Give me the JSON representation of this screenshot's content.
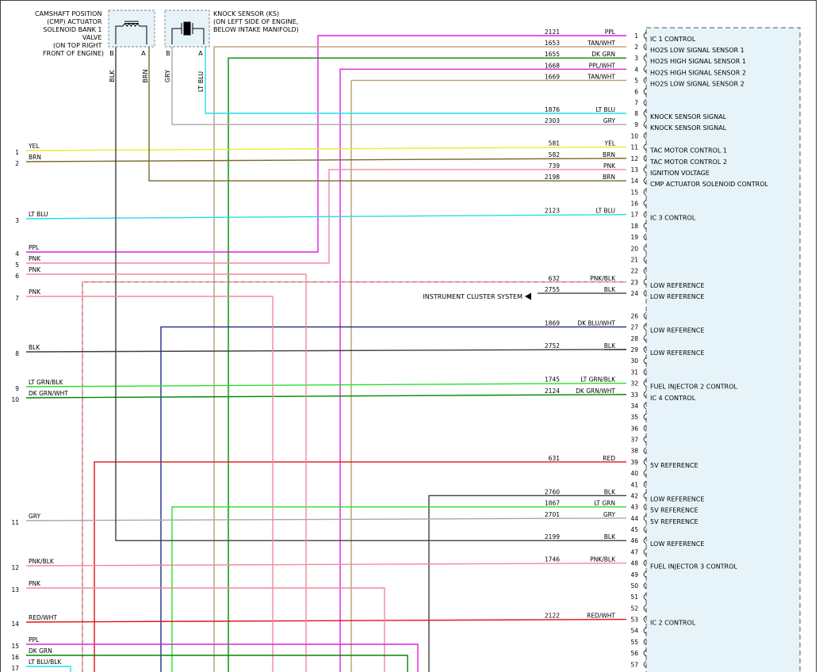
{
  "components": {
    "cmp": {
      "label": [
        "CAMSHAFT POSITION",
        "(CMP) ACTUATOR",
        "SOLENOID BANK 1",
        "VALVE",
        "(ON TOP RIGHT",
        "FRONT OF ENGINE)"
      ],
      "pins": [
        "B",
        "A"
      ],
      "wires": [
        "BLK",
        "BRN"
      ]
    },
    "ks": {
      "label": [
        "KNOCK SENSOR (KS)",
        "(ON LEFT SIDE OF ENGINE,",
        "BELOW INTAKE MANIFOLD)"
      ],
      "pins": [
        "B",
        "A"
      ],
      "wires": [
        "GRY",
        "LT BLU"
      ]
    }
  },
  "reference": {
    "label": "INSTRUMENT CLUSTER SYSTEM",
    "arrow": "arrow-left-icon"
  },
  "module_pins": [
    {
      "pin": "1",
      "circuit": "2121",
      "color": "PPL",
      "function": "IC 1 CONTROL"
    },
    {
      "pin": "2",
      "circuit": "1653",
      "color": "TAN/WHT",
      "function": "HO2S LOW SIGNAL SENSOR 1"
    },
    {
      "pin": "3",
      "circuit": "1655",
      "color": "DK GRN",
      "function": "HO2S HIGH SIGNAL SENSOR 1"
    },
    {
      "pin": "4",
      "circuit": "1668",
      "color": "PPL/WHT",
      "function": "HO2S HIGH SIGNAL SENSOR 2"
    },
    {
      "pin": "5",
      "circuit": "1669",
      "color": "TAN/WHT",
      "function": "HO2S LOW SIGNAL SENSOR 2"
    },
    {
      "pin": "6"
    },
    {
      "pin": "7"
    },
    {
      "pin": "8",
      "circuit": "1876",
      "color": "LT BLU",
      "function": "KNOCK SENSOR SIGNAL"
    },
    {
      "pin": "9",
      "circuit": "2303",
      "color": "GRY",
      "function": "KNOCK SENSOR SIGNAL"
    },
    {
      "pin": "10"
    },
    {
      "pin": "11",
      "circuit": "581",
      "color": "YEL",
      "function": "TAC MOTOR CONTROL 1"
    },
    {
      "pin": "12",
      "circuit": "582",
      "color": "BRN",
      "function": "TAC MOTOR CONTROL 2"
    },
    {
      "pin": "13",
      "circuit": "739",
      "color": "PNK",
      "function": "IGNITION VOLTAGE"
    },
    {
      "pin": "14",
      "circuit": "2198",
      "color": "BRN",
      "function": "CMP ACTUATOR SOLENOID CONTROL"
    },
    {
      "pin": "15"
    },
    {
      "pin": "16"
    },
    {
      "pin": "17",
      "circuit": "2123",
      "color": "LT BLU",
      "function": "IC 3 CONTROL"
    },
    {
      "pin": "18"
    },
    {
      "pin": "19"
    },
    {
      "pin": "20"
    },
    {
      "pin": "21"
    },
    {
      "pin": "22"
    },
    {
      "pin": "23",
      "circuit": "632",
      "color": "PNK/BLK",
      "function": "LOW REFERENCE"
    },
    {
      "pin": "24",
      "circuit": "2755",
      "color": "BLK",
      "function": "LOW REFERENCE"
    },
    {
      "pin": "26"
    },
    {
      "pin": "27",
      "circuit": "1869",
      "color": "DK BLU/WHT",
      "function": "LOW REFERENCE"
    },
    {
      "pin": "28"
    },
    {
      "pin": "29",
      "circuit": "2752",
      "color": "BLK",
      "function": "LOW REFERENCE"
    },
    {
      "pin": "30"
    },
    {
      "pin": "31"
    },
    {
      "pin": "32",
      "circuit": "1745",
      "color": "LT GRN/BLK",
      "function": "FUEL INJECTOR 2 CONTROL"
    },
    {
      "pin": "33",
      "circuit": "2124",
      "color": "DK GRN/WHT",
      "function": "IC 4 CONTROL"
    },
    {
      "pin": "34"
    },
    {
      "pin": "35"
    },
    {
      "pin": "36"
    },
    {
      "pin": "37"
    },
    {
      "pin": "38"
    },
    {
      "pin": "39",
      "circuit": "631",
      "color": "RED",
      "function": "5V REFERENCE"
    },
    {
      "pin": "40"
    },
    {
      "pin": "41"
    },
    {
      "pin": "42",
      "circuit": "2760",
      "color": "BLK",
      "function": "LOW REFERENCE"
    },
    {
      "pin": "43",
      "circuit": "1867",
      "color": "LT GRN",
      "function": "5V REFERENCE"
    },
    {
      "pin": "44",
      "circuit": "2701",
      "color": "GRY",
      "function": "5V REFERENCE"
    },
    {
      "pin": "45"
    },
    {
      "pin": "46",
      "circuit": "2199",
      "color": "BLK",
      "function": "LOW REFERENCE"
    },
    {
      "pin": "47"
    },
    {
      "pin": "48",
      "circuit": "1746",
      "color": "PNK/BLK",
      "function": "FUEL INJECTOR 3 CONTROL"
    },
    {
      "pin": "49"
    },
    {
      "pin": "50"
    },
    {
      "pin": "51"
    },
    {
      "pin": "52"
    },
    {
      "pin": "53",
      "circuit": "2122",
      "color": "RED/WHT",
      "function": "IC 2 CONTROL"
    },
    {
      "pin": "54"
    },
    {
      "pin": "55"
    },
    {
      "pin": "56"
    },
    {
      "pin": "57"
    }
  ],
  "left_connector": [
    {
      "pin": "1",
      "color": "YEL"
    },
    {
      "pin": "2",
      "color": "BRN"
    },
    {
      "pin": "3",
      "color": "LT BLU"
    },
    {
      "pin": "4",
      "color": "PPL"
    },
    {
      "pin": "5",
      "color": "PNK"
    },
    {
      "pin": "6",
      "color": "PNK"
    },
    {
      "pin": "7",
      "color": "PNK"
    },
    {
      "pin": "8",
      "color": "BLK"
    },
    {
      "pin": "9",
      "color": "LT GRN/BLK"
    },
    {
      "pin": "10",
      "color": "DK GRN/WHT"
    },
    {
      "pin": "11",
      "color": "GRY"
    },
    {
      "pin": "12",
      "color": "PNK/BLK"
    },
    {
      "pin": "13",
      "color": "PNK"
    },
    {
      "pin": "14",
      "color": "RED/WHT"
    },
    {
      "pin": "15",
      "color": "PPL"
    },
    {
      "pin": "16",
      "color": "DK GRN"
    },
    {
      "pin": "17",
      "color": "LT BLU/BLK"
    }
  ],
  "wire_colors": {
    "PPL": "#e020e0",
    "TAN": "#b89c78",
    "DK GRN": "#008a00",
    "LT BLU": "#22dded",
    "GRY": "#a8a8a8",
    "YEL": "#ecec28",
    "BRN": "#7a6a2c",
    "PNK": "#f08c9c",
    "BLK": "#404040",
    "DK BLU": "#1e2a8c",
    "LT GRN": "#28e028",
    "RED": "#e01414",
    "module_fill": "#e6f4fa"
  }
}
